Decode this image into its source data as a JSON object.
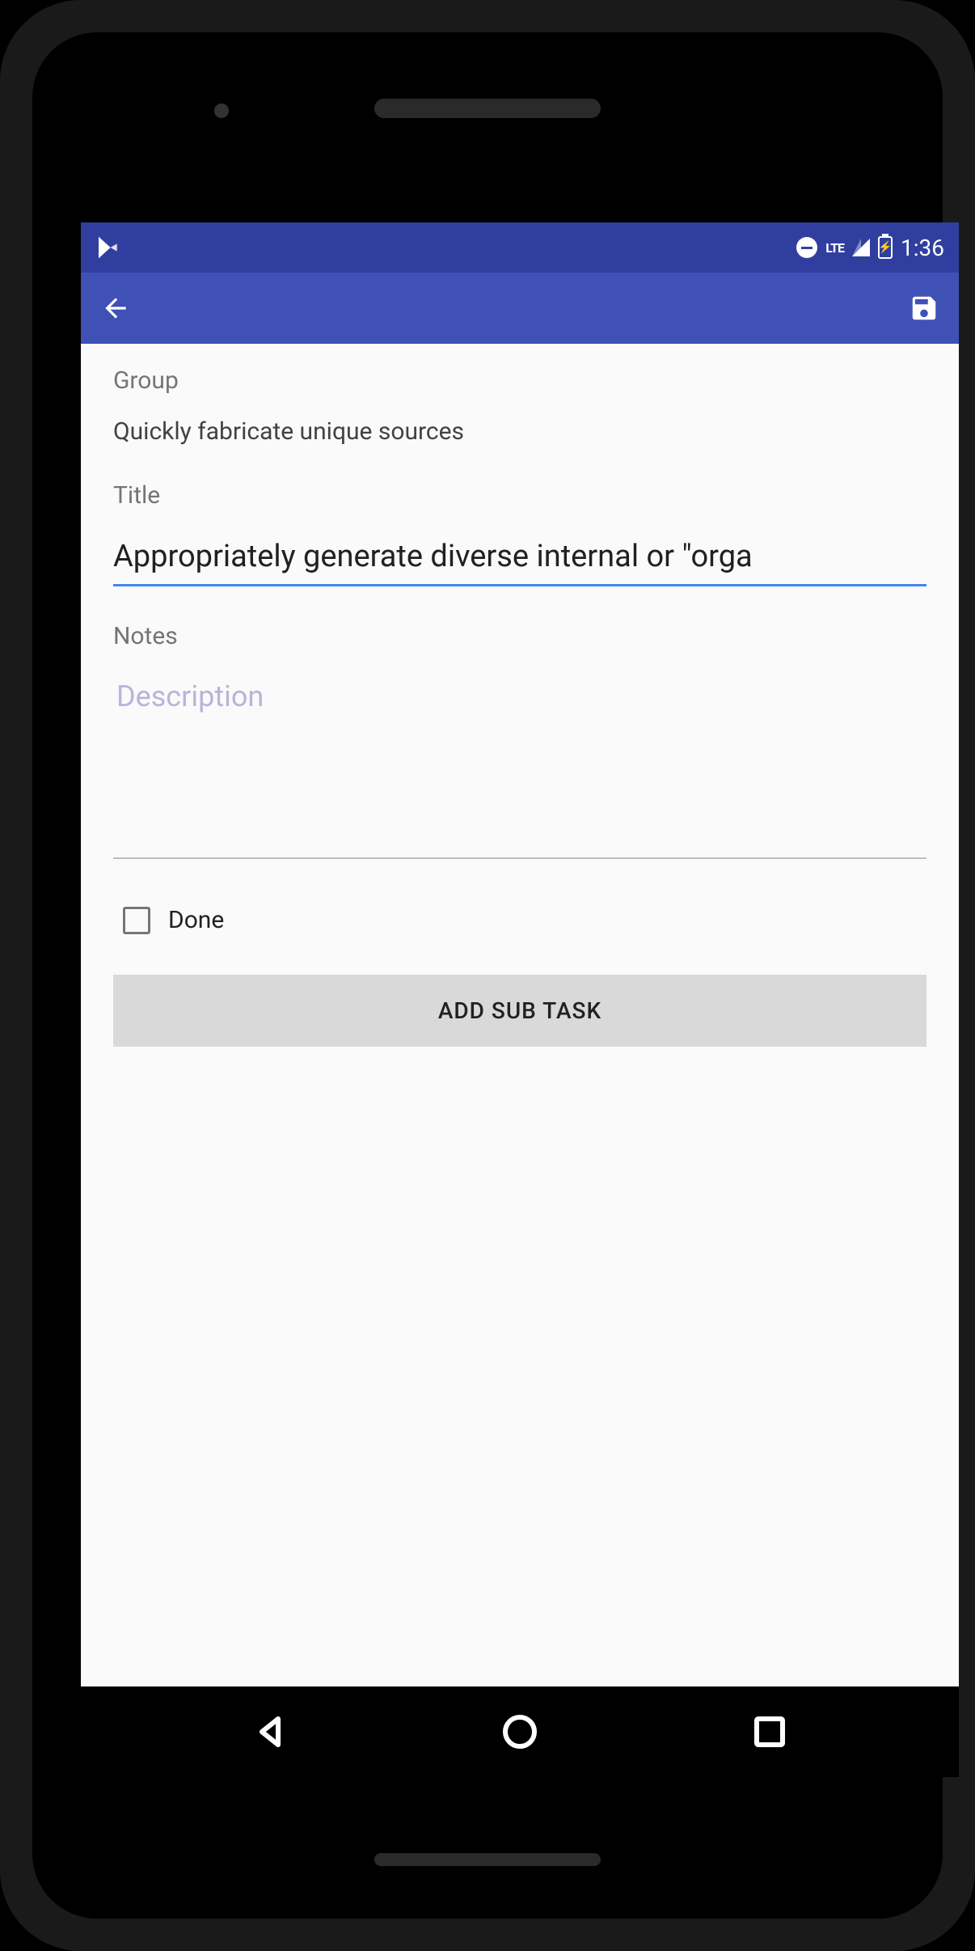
{
  "status_bar": {
    "lte_label": "LTE",
    "clock": "1:36"
  },
  "form": {
    "group_label": "Group",
    "group_value": "Quickly fabricate unique sources",
    "title_label": "Title",
    "title_value": "Appropriately generate diverse internal or \"orga",
    "notes_label": "Notes",
    "notes_placeholder": "Description",
    "notes_value": "",
    "done_label": "Done",
    "done_checked": false,
    "add_subtask_label": "ADD SUB TASK"
  }
}
